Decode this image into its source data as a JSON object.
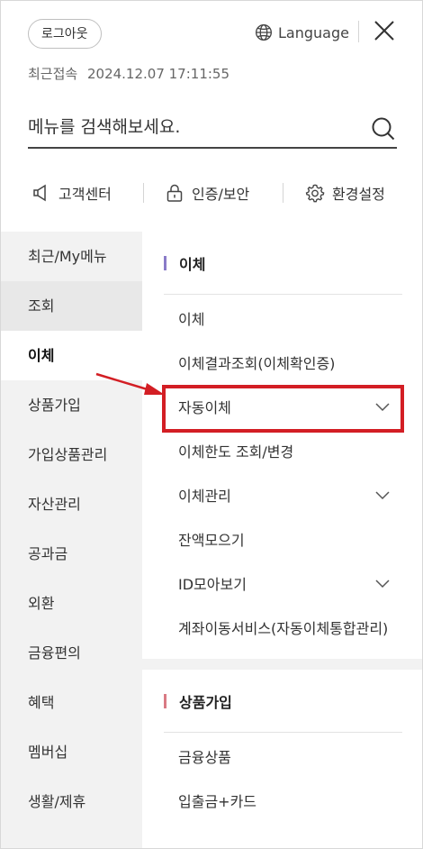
{
  "header": {
    "logout_label": "로그아웃",
    "language_label": "Language",
    "last_login_label": "최근접속",
    "last_login_time": "2024.12.07 17:11:55",
    "search_placeholder": "메뉴를 검색해보세요."
  },
  "quick_menu": [
    {
      "label": "고객센터",
      "icon": "speaker-icon"
    },
    {
      "label": "인증/보안",
      "icon": "lock-icon"
    },
    {
      "label": "환경설정",
      "icon": "gear-icon"
    }
  ],
  "sidebar": {
    "items": [
      {
        "label": "최근/My메뉴"
      },
      {
        "label": "조회"
      },
      {
        "label": "이체"
      },
      {
        "label": "상품가입"
      },
      {
        "label": "가입상품관리"
      },
      {
        "label": "자산관리"
      },
      {
        "label": "공과금"
      },
      {
        "label": "외환"
      },
      {
        "label": "금융편의"
      },
      {
        "label": "혜택"
      },
      {
        "label": "멤버십"
      },
      {
        "label": "생활/제휴"
      }
    ]
  },
  "sections": [
    {
      "title": "이체",
      "bar_color": "#8a7bc8",
      "items": [
        {
          "label": "이체"
        },
        {
          "label": "이체결과조회(이체확인증)"
        },
        {
          "label": "자동이체"
        },
        {
          "label": "이체한도 조회/변경"
        },
        {
          "label": "이체관리"
        },
        {
          "label": "잔액모으기"
        },
        {
          "label": "ID모아보기"
        },
        {
          "label": "계좌이동서비스(자동이체통합관리)"
        }
      ]
    },
    {
      "title": "상품가입",
      "bar_color": "#d97a84",
      "items": [
        {
          "label": "금융상품"
        },
        {
          "label": "입출금+카드"
        }
      ]
    }
  ],
  "colors": {
    "highlight_box": "#d31e24",
    "annotation_arrow": "#d31e24"
  }
}
